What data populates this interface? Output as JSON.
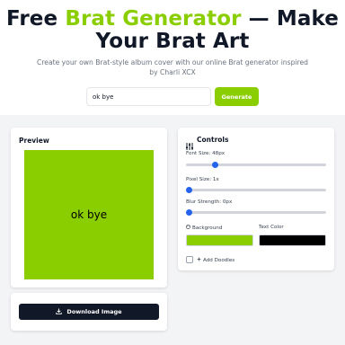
{
  "header": {
    "title_part1": "Free ",
    "title_accent": "Brat Generator",
    "title_part2": " — Make",
    "title_line2": "Your Brat Art",
    "subtitle": "Create your own Brat-style album cover with our online Brat generator inspired by Charli XCX"
  },
  "search": {
    "value": "ok bye",
    "button_label": "Generate"
  },
  "preview": {
    "title": "Preview",
    "cover_text": "ok bye",
    "background_color": "#8ace00",
    "text_color": "#000000"
  },
  "controls": {
    "title": "Controls",
    "icon": "sliders-icon",
    "font_size": {
      "label": "Font Size: 48px",
      "value_fraction": 0.17
    },
    "pixel_size": {
      "label": "Pixel Size: 1x",
      "value_fraction": 0.0
    },
    "blur_strength": {
      "label": "Blur Strength: 0px",
      "value_fraction": 0.0
    },
    "background_label": "Background",
    "background_icon": "palette-icon",
    "text_color_label": "Text Color",
    "doodles_label": "Add Doodles",
    "doodles_icon": "sparkle-icon",
    "doodles_checked": false
  },
  "download": {
    "label": "Download Image",
    "icon": "download-icon"
  },
  "colors": {
    "accent": "#8ace00",
    "dark": "#111827",
    "slider": "#2563eb"
  }
}
